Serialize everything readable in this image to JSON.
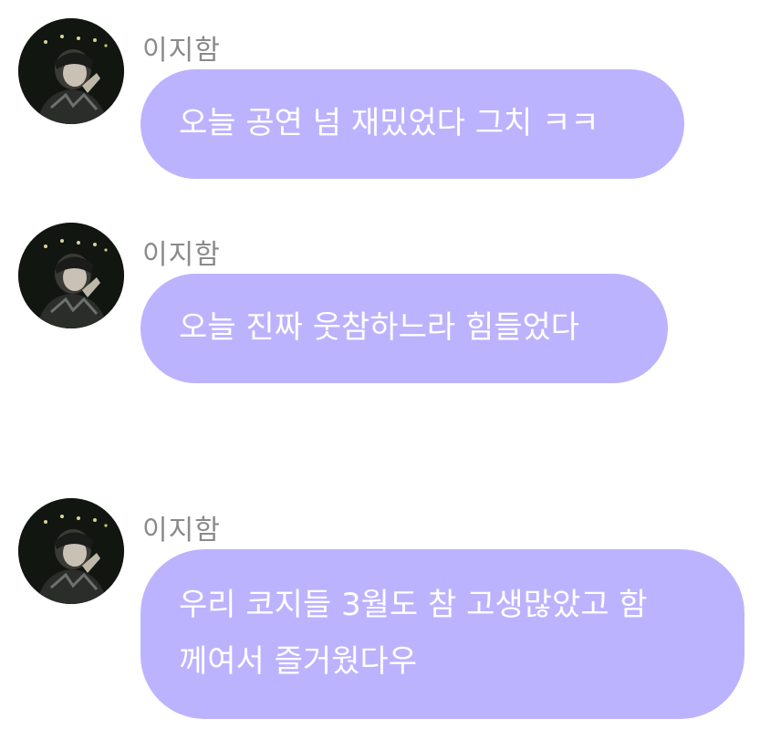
{
  "messages": [
    {
      "sender": "이지함",
      "text": "오늘 공연 넘 재밌었다 그치 ㅋㅋ"
    },
    {
      "sender": "이지함",
      "text": "오늘 진짜 웃참하느라 힘들었다"
    },
    {
      "sender": "이지함",
      "text_line1": "우리 코지들 3월도 참 고생많았고 함",
      "text_line2": "께여서 즐거웠다우"
    }
  ],
  "colors": {
    "bubble": "#bcb3ff",
    "bubble_text": "#ffffff",
    "sender_text": "#8a8a8a",
    "background": "#ffffff"
  },
  "icons": {
    "avatar": "profile-photo"
  }
}
